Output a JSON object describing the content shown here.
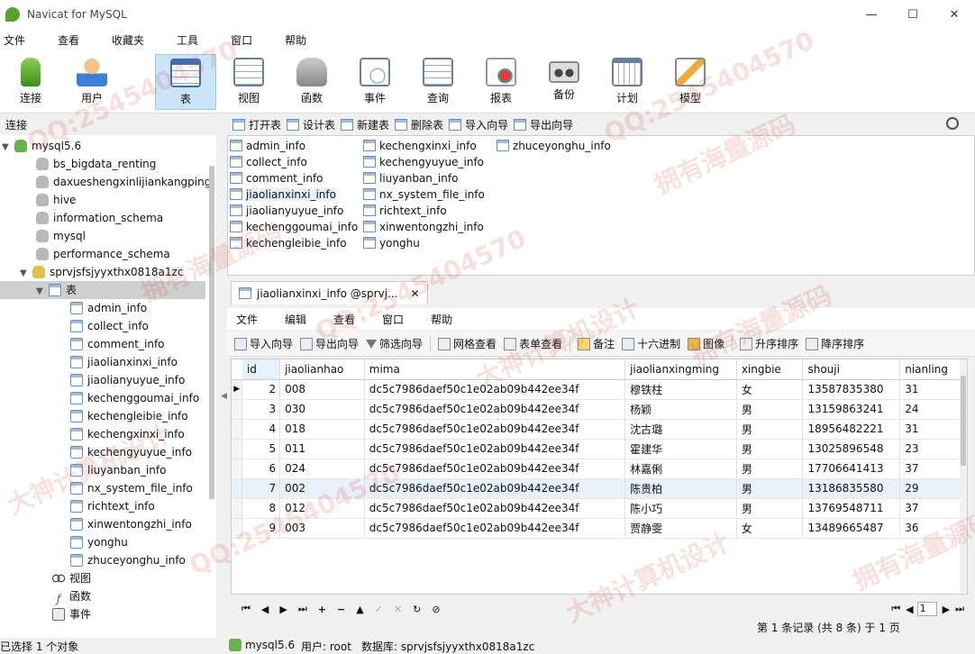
{
  "window": {
    "title": "Navicat for MySQL",
    "minimize": "—",
    "maximize": "☐",
    "close": "✕"
  },
  "menu": [
    "文件",
    "查看",
    "收藏夹",
    "工具",
    "窗口",
    "帮助"
  ],
  "toolbar": [
    {
      "label": "连接",
      "icon": "connect-icon"
    },
    {
      "label": "用户",
      "icon": "user-icon"
    },
    {
      "label": "表",
      "icon": "table-icon",
      "active": true
    },
    {
      "label": "视图",
      "icon": "view-icon"
    },
    {
      "label": "函数",
      "icon": "function-icon"
    },
    {
      "label": "事件",
      "icon": "event-icon"
    },
    {
      "label": "查询",
      "icon": "query-icon"
    },
    {
      "label": "报表",
      "icon": "report-icon"
    },
    {
      "label": "备份",
      "icon": "backup-icon"
    },
    {
      "label": "计划",
      "icon": "schedule-icon"
    },
    {
      "label": "模型",
      "icon": "model-icon"
    }
  ],
  "nav": {
    "header": "连接",
    "connection": "mysql5.6",
    "databases": [
      "bs_bigdata_renting",
      "daxueshengxinlijiankangping",
      "hive",
      "information_schema",
      "mysql",
      "performance_schema"
    ],
    "open_db": "sprvjsfsjyyxthx0818a1zc",
    "tables_folder": "表",
    "tables": [
      "admin_info",
      "collect_info",
      "comment_info",
      "jiaolianxinxi_info",
      "jiaolianyuyue_info",
      "kechenggoumai_info",
      "kechengleibie_info",
      "kechengxinxi_info",
      "kechengyuyue_info",
      "liuyanban_info",
      "nx_system_file_info",
      "richtext_info",
      "xinwentongzhi_info",
      "yonghu",
      "zhuceyonghu_info"
    ],
    "other_folders": [
      "视图",
      "函数",
      "事件"
    ]
  },
  "object_toolbar": [
    "打开表",
    "设计表",
    "新建表",
    "删除表",
    "导入向导",
    "导出向导"
  ],
  "objects": {
    "col1": [
      "admin_info",
      "collect_info",
      "comment_info",
      "jiaolianxinxi_info",
      "jiaolianyuyue_info",
      "kechenggoumai_info",
      "kechengleibie_info"
    ],
    "col2": [
      "kechengxinxi_info",
      "kechengyuyue_info",
      "liuyanban_info",
      "nx_system_file_info",
      "richtext_info",
      "xinwentongzhi_info",
      "yonghu"
    ],
    "col3": [
      "zhuceyonghu_info"
    ]
  },
  "tab": {
    "label": "jiaolianxinxi_info @sprvj...",
    "close": "✕"
  },
  "sub_menu": [
    "文件",
    "编辑",
    "查看",
    "窗口",
    "帮助"
  ],
  "sub_toolbar": [
    "导入向导",
    "导出向导",
    "筛选向导",
    "网格查看",
    "表单查看",
    "备注",
    "十六进制",
    "图像",
    "升序排序",
    "降序排序"
  ],
  "grid": {
    "columns": [
      "id",
      "jiaolianhao",
      "mima",
      "jiaolianxingming",
      "xingbie",
      "shouji",
      "nianling"
    ],
    "rows": [
      [
        "2",
        "008",
        "dc5c7986daef50c1e02ab09b442ee34f",
        "穆铁柱",
        "女",
        "13587835380",
        "31"
      ],
      [
        "3",
        "030",
        "dc5c7986daef50c1e02ab09b442ee34f",
        "杨颖",
        "男",
        "13159863241",
        "24"
      ],
      [
        "4",
        "018",
        "dc5c7986daef50c1e02ab09b442ee34f",
        "沈古璐",
        "男",
        "18956482221",
        "31"
      ],
      [
        "5",
        "011",
        "dc5c7986daef50c1e02ab09b442ee34f",
        "霍建华",
        "男",
        "13025896548",
        "23"
      ],
      [
        "6",
        "024",
        "dc5c7986daef50c1e02ab09b442ee34f",
        "林嘉俐",
        "男",
        "17706641413",
        "37"
      ],
      [
        "7",
        "002",
        "dc5c7986daef50c1e02ab09b442ee34f",
        "陈贵柏",
        "男",
        "13186835580",
        "29"
      ],
      [
        "8",
        "012",
        "dc5c7986daef50c1e02ab09b442ee34f",
        "陈小巧",
        "男",
        "13769548711",
        "37"
      ],
      [
        "9",
        "003",
        "dc5c7986daef50c1e02ab09b442ee34f",
        "贾静雯",
        "女",
        "13489665487",
        "36"
      ]
    ]
  },
  "pager": {
    "page": "1",
    "record_info": "第 1 条记录 (共 8 条) 于 1 页"
  },
  "status": {
    "selection": "已选择 1 个对象",
    "connection": "mysql5.6",
    "user": "用户: root",
    "database": "数据库: sprvjsfsjyyxthx0818a1zc"
  },
  "watermark": [
    "QQ:2545404570",
    "拥有海量源码",
    "大神计算机设计"
  ]
}
